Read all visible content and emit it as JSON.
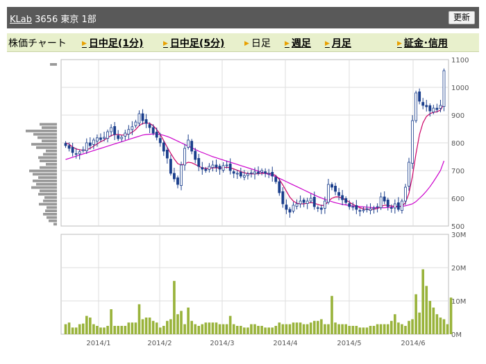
{
  "header": {
    "ticker_link": "KLab",
    "code": "3656",
    "market": "東京 1部",
    "refresh_label": "更新"
  },
  "tabs": [
    {
      "label": "株価チャート",
      "linked": false,
      "arrow": false
    },
    {
      "label": "日中足(1分)",
      "linked": true,
      "arrow": true
    },
    {
      "label": "日中足(5分)",
      "linked": true,
      "arrow": true
    },
    {
      "label": "日足",
      "linked": false,
      "arrow": true
    },
    {
      "label": "週足",
      "linked": true,
      "arrow": true
    },
    {
      "label": "月足",
      "linked": true,
      "arrow": true
    },
    {
      "label": "証金･信用",
      "linked": true,
      "arrow": true
    }
  ],
  "colors": {
    "candle": "#1a3e8c",
    "ma_short": "#cc0066",
    "ma_long": "#cc00cc",
    "volume": "#99b33b",
    "volume_profile": "#999999",
    "grid": "#dddddd",
    "panel_border": "#bbbbbb"
  },
  "chart_data": [
    {
      "type": "candlestick",
      "panel": "price",
      "ylim": [
        500,
        1100
      ],
      "yticks": [
        "500",
        "600",
        "700",
        "800",
        "900",
        "1000",
        "1100"
      ],
      "xtick_labels": [
        "2014/1",
        "2014/2",
        "2014/3",
        "2014/4",
        "2014/5",
        "2014/6"
      ],
      "close": [
        790,
        780,
        765,
        760,
        768,
        775,
        800,
        790,
        810,
        818,
        812,
        820,
        840,
        855,
        830,
        815,
        820,
        835,
        848,
        858,
        875,
        905,
        880,
        870,
        855,
        835,
        820,
        800,
        770,
        745,
        690,
        670,
        650,
        720,
        780,
        810,
        770,
        740,
        715,
        705,
        700,
        715,
        720,
        712,
        705,
        718,
        720,
        700,
        690,
        690,
        680,
        682,
        688,
        692,
        695,
        690,
        700,
        690,
        690,
        680,
        660,
        620,
        580,
        560,
        550,
        575,
        580,
        590,
        585,
        590,
        600,
        570,
        565,
        560,
        590,
        650,
        640,
        625,
        610,
        595,
        585,
        570,
        570,
        560,
        555,
        558,
        560,
        562,
        565,
        570,
        605,
        590,
        570,
        565,
        580,
        560,
        590,
        640,
        730,
        880,
        980,
        950,
        935,
        930,
        915,
        925,
        920,
        935,
        1060
      ],
      "ma_short": [
        800,
        795,
        785,
        778,
        775,
        773,
        775,
        780,
        788,
        796,
        804,
        810,
        818,
        826,
        830,
        830,
        828,
        828,
        832,
        838,
        848,
        862,
        870,
        872,
        870,
        862,
        848,
        830,
        808,
        784,
        762,
        742,
        725,
        720,
        724,
        730,
        728,
        722,
        715,
        710,
        708,
        708,
        710,
        710,
        709,
        710,
        712,
        710,
        706,
        701,
        696,
        692,
        689,
        688,
        688,
        689,
        690,
        690,
        690,
        688,
        682,
        668,
        648,
        626,
        604,
        590,
        582,
        580,
        580,
        582,
        585,
        582,
        578,
        574,
        575,
        590,
        600,
        605,
        605,
        600,
        594,
        586,
        578,
        572,
        566,
        562,
        560,
        560,
        561,
        563,
        570,
        575,
        575,
        572,
        572,
        570,
        572,
        584,
        618,
        680,
        760,
        830,
        872,
        895,
        905,
        910,
        912,
        918,
        940
      ],
      "ma_long": [
        740,
        744,
        748,
        752,
        756,
        760,
        764,
        768,
        772,
        776,
        780,
        784,
        788,
        792,
        796,
        800,
        804,
        808,
        812,
        816,
        820,
        824,
        828,
        830,
        831,
        832,
        832,
        830,
        827,
        823,
        818,
        812,
        806,
        800,
        794,
        788,
        782,
        776,
        770,
        765,
        760,
        755,
        750,
        746,
        742,
        738,
        734,
        730,
        726,
        722,
        718,
        714,
        710,
        706,
        702,
        698,
        694,
        690,
        686,
        682,
        678,
        672,
        666,
        660,
        654,
        648,
        642,
        636,
        630,
        624,
        618,
        612,
        606,
        601,
        596,
        592,
        588,
        584,
        581,
        578,
        576,
        574,
        572,
        571,
        570,
        569,
        568,
        567,
        566,
        566,
        566,
        566,
        567,
        568,
        569,
        570,
        571,
        573,
        576,
        580,
        588,
        600,
        612,
        626,
        642,
        660,
        680,
        700,
        735
      ]
    },
    {
      "type": "bar",
      "panel": "volume",
      "ylim": [
        0,
        30
      ],
      "yticks": [
        "0M",
        "10M",
        "20M",
        "30M"
      ],
      "values": [
        3,
        3.5,
        2,
        2,
        3,
        3.2,
        5.5,
        5,
        3,
        2.5,
        2,
        2,
        2.5,
        7.5,
        2.5,
        2.5,
        2.5,
        2.5,
        3.5,
        3.5,
        3.5,
        9,
        4.5,
        5,
        5,
        4,
        3.5,
        2,
        2.5,
        4,
        4.5,
        16,
        6,
        7,
        3,
        8,
        4,
        3,
        2.5,
        3,
        3.5,
        3.5,
        3.5,
        3.5,
        3,
        3,
        3,
        5.5,
        3,
        2.5,
        2.5,
        2,
        2,
        3,
        3,
        2.5,
        2.5,
        2,
        2,
        2,
        2.5,
        3.5,
        3,
        3,
        3,
        3.5,
        3.5,
        3.5,
        3,
        3,
        3.5,
        4,
        4,
        4.5,
        3,
        3,
        11.5,
        3.5,
        3,
        3,
        3,
        2.5,
        2.5,
        2.5,
        2,
        2,
        2,
        2.5,
        2.5,
        3,
        3,
        3,
        3,
        4,
        6,
        3.5,
        3,
        2.5,
        4,
        4.5,
        12,
        6.5,
        19.5,
        14.5,
        10,
        8,
        6,
        5,
        4.5,
        3,
        11
      ]
    },
    {
      "type": "bar",
      "panel": "volume_profile",
      "orientation": "horizontal",
      "values": [
        10,
        0,
        0,
        0,
        0,
        0,
        0,
        0,
        0,
        0,
        0,
        0,
        0,
        0,
        0,
        0,
        0,
        0,
        25,
        22,
        45,
        34,
        28,
        22,
        37,
        30,
        16,
        20,
        27,
        25,
        16,
        25,
        40,
        35,
        27,
        35,
        30,
        37,
        25,
        27,
        18,
        20,
        26,
        15,
        17,
        20,
        15,
        12,
        5
      ]
    }
  ]
}
